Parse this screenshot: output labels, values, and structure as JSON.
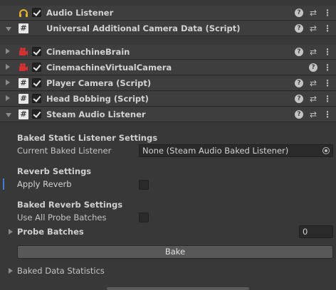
{
  "components": [
    {
      "id": "audio-listener",
      "title": "Audio Listener",
      "fold": "none",
      "icon": "headphones-icon",
      "checkbox": true,
      "help": true
    },
    {
      "id": "universal-camera-data",
      "title": "Universal Additional Camera Data (Script)",
      "fold": "down",
      "icon": "script-icon",
      "checkbox": false,
      "help": true
    },
    {
      "id": "cinemachine-brain",
      "title": "CinemachineBrain",
      "fold": "right",
      "icon": "cinemachine-icon",
      "checkbox": true,
      "help": true
    },
    {
      "id": "cinemachine-vcam",
      "title": "CinemachineVirtualCamera",
      "fold": "right",
      "icon": "cinemachine-icon",
      "checkbox": true,
      "help": true
    },
    {
      "id": "player-camera",
      "title": "Player Camera (Script)",
      "fold": "right",
      "icon": "script-icon",
      "checkbox": true,
      "help": true
    },
    {
      "id": "head-bobbing",
      "title": "Head Bobbing (Script)",
      "fold": "right",
      "icon": "script-icon",
      "checkbox": true,
      "help": true
    },
    {
      "id": "steam-audio-listener",
      "title": "Steam Audio Listener",
      "fold": "down",
      "icon": "script-icon",
      "checkbox": true,
      "help": true
    }
  ],
  "glyphs": {
    "script": "#",
    "help": "?",
    "preset": "⇄",
    "menu": "⋮"
  },
  "steam": {
    "baked_static_section": "Baked Static Listener Settings",
    "current_baked_label": "Current Baked Listener",
    "current_baked_value": "None (Steam Audio Baked Listener)",
    "reverb_section": "Reverb Settings",
    "apply_reverb_label": "Apply Reverb",
    "baked_reverb_section": "Baked Reverb Settings",
    "use_all_probe_label": "Use All Probe Batches",
    "probe_batches_label": "Probe Batches",
    "probe_batches_value": "0",
    "bake_button": "Bake",
    "baked_data_stats_label": "Baked Data Statistics"
  },
  "colors": {
    "background": "#383838",
    "header": "#3e3e3e",
    "accent": "#3d7ed1",
    "headphones": "#e8b62a",
    "cinemachine": "#d23232"
  }
}
